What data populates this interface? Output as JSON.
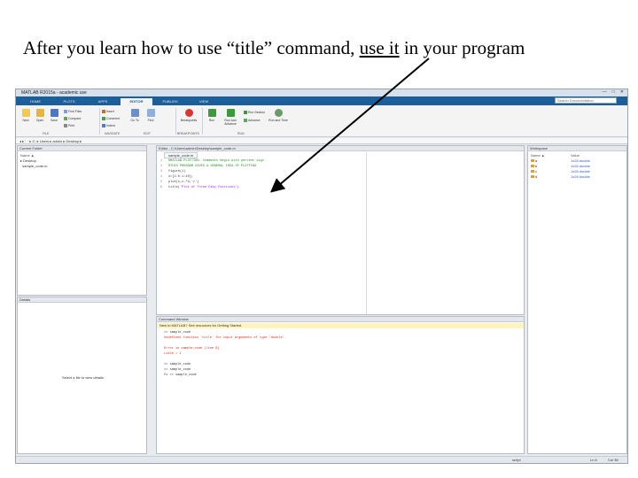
{
  "caption": {
    "part1": "After you learn how to use “title” command, ",
    "part2": "use it",
    "part3": " in your program"
  },
  "window": {
    "title": "MATLAB R2015a - academic use",
    "controls": [
      "—",
      "□",
      "✕"
    ]
  },
  "tabs": [
    "HOME",
    "PLOTS",
    "APPS",
    "EDITOR",
    "PUBLISH",
    "VIEW"
  ],
  "search_placeholder": "Search Documentation",
  "ribbon": {
    "new": "New",
    "open": "Open",
    "save": "Save",
    "find_files": "Find Files",
    "compare": "Compare",
    "print": "Print",
    "insert": "Insert",
    "comment": "Comment",
    "indent": "Indent",
    "go_to": "Go To",
    "find": "Find",
    "breakpoints": "Breakpoints",
    "run": "Run",
    "run_advance": "Run and Advance",
    "run_section": "Run Section",
    "advance": "Advance",
    "run_time": "Run and Time",
    "groups": [
      "FILE",
      "NAVIGATE",
      "EDIT",
      "BREAKPOINTS",
      "RUN"
    ]
  },
  "address": "◂ ▸ 🗀 ▸ C: ▸ Users ▸ admin ▸ Desktop ▸",
  "current_folder": {
    "title": "Current Folder",
    "col": "Name ▲",
    "items": [
      "Desktop",
      "sample_code.m"
    ]
  },
  "details": {
    "title": "Details",
    "hint": "Select a file to view details"
  },
  "editor": {
    "title": "Editor - C:\\Users\\admin\\Desktop\\sample_code.m",
    "tab": "sample_code.m",
    "lines": [
      {
        "n": "1",
        "pre": "",
        "cmt": "%MATLAB PLOTTING: Comments begin with percent sign",
        "post": ""
      },
      {
        "n": "2",
        "pre": "",
        "cmt": "%THIS PROGRAM GIVES A GENERAL IDEA OF PLOTTING",
        "post": ""
      },
      {
        "n": "3",
        "pre": "figure(1)",
        "cmt": "",
        "post": ""
      },
      {
        "n": "4",
        "pre": "x=[1:0.1:10];",
        "cmt": "",
        "post": ""
      },
      {
        "n": "5",
        "pre": "plot(x,x.^2,'r')",
        "cmt": "",
        "post": ""
      },
      {
        "n": "6",
        "pre": "title(",
        "str": "'Plot of Three Easy Functions'",
        "post": ")"
      }
    ]
  },
  "command_window": {
    "title": "Command Window",
    "notice": "New to MATLAB? See resources for Getting Started.",
    "lines": [
      {
        "text": ">> sample_code",
        "err": false
      },
      {
        "text": "Undefined function 'title' for input arguments of type 'double'.",
        "err": true
      },
      {
        "text": "",
        "err": false
      },
      {
        "text": "Error in sample_code (line 6)",
        "err": true
      },
      {
        "text": "title = 1",
        "err": true
      },
      {
        "text": "",
        "err": false
      },
      {
        "text": ">> sample_code",
        "err": false
      },
      {
        "text": ">> sample_code",
        "err": false
      },
      {
        "text": "fx >> sample_code",
        "err": false
      }
    ]
  },
  "workspace": {
    "title": "Workspace",
    "cols": [
      "Name ▲",
      "Value"
    ],
    "rows": [
      {
        "name": "a",
        "value": "1x26 double"
      },
      {
        "name": "b",
        "value": "1x26 double"
      },
      {
        "name": "c",
        "value": "1x26 double"
      },
      {
        "name": "d",
        "value": "1x26 double"
      }
    ]
  },
  "status": {
    "left": "",
    "script": "script",
    "ln": "Ln 6",
    "col": "Col 38"
  },
  "colors": {
    "tab_bar": "#1c5e9a",
    "error": "#e3220b",
    "comment": "#228b22",
    "string": "#a020f0",
    "arrow": "#000000"
  }
}
